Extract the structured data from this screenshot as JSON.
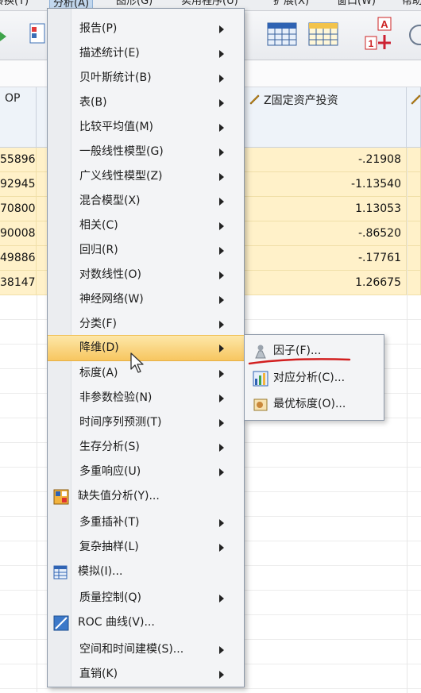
{
  "menubar": {
    "items": [
      "转换(T)",
      "分析(A)",
      "图形(G)",
      "实用程序(U)",
      "扩展(X)",
      "窗口(W)",
      "帮助"
    ]
  },
  "grid": {
    "headers": [
      "OP",
      "",
      "Z固定资产投资"
    ],
    "left_values": [
      "55896",
      "92945",
      "70800",
      "90008",
      "49886",
      "38147"
    ],
    "right_values": [
      "-.21908",
      "-1.13540",
      "1.13053",
      "-.86520",
      "-.17761",
      "1.26675"
    ]
  },
  "menu": {
    "items": [
      {
        "label": "报告(P)",
        "submenu": true
      },
      {
        "label": "描述统计(E)",
        "submenu": true
      },
      {
        "label": "贝叶斯统计(B)",
        "submenu": true
      },
      {
        "label": "表(B)",
        "submenu": true
      },
      {
        "label": "比较平均值(M)",
        "submenu": true
      },
      {
        "label": "一般线性模型(G)",
        "submenu": true
      },
      {
        "label": "广义线性模型(Z)",
        "submenu": true
      },
      {
        "label": "混合模型(X)",
        "submenu": true
      },
      {
        "label": "相关(C)",
        "submenu": true
      },
      {
        "label": "回归(R)",
        "submenu": true
      },
      {
        "label": "对数线性(O)",
        "submenu": true
      },
      {
        "label": "神经网络(W)",
        "submenu": true
      },
      {
        "label": "分类(F)",
        "submenu": true
      },
      {
        "label": "降维(D)",
        "submenu": true,
        "highlighted": true
      },
      {
        "label": "标度(A)",
        "submenu": true
      },
      {
        "label": "非参数检验(N)",
        "submenu": true
      },
      {
        "label": "时间序列预测(T)",
        "submenu": true
      },
      {
        "label": "生存分析(S)",
        "submenu": true
      },
      {
        "label": "多重响应(U)",
        "submenu": true
      },
      {
        "label": "缺失值分析(Y)...",
        "submenu": false,
        "icon": "missing-value-icon"
      },
      {
        "label": "多重插补(T)",
        "submenu": true
      },
      {
        "label": "复杂抽样(L)",
        "submenu": true
      },
      {
        "label": "模拟(I)...",
        "submenu": false,
        "icon": "simulation-icon"
      },
      {
        "label": "质量控制(Q)",
        "submenu": true
      },
      {
        "label": "ROC 曲线(V)...",
        "submenu": false,
        "icon": "roc-curve-icon"
      },
      {
        "label": "空间和时间建模(S)...",
        "submenu": true
      },
      {
        "label": "直销(K)",
        "submenu": true
      }
    ]
  },
  "submenu": {
    "items": [
      {
        "label": "因子(F)...",
        "icon": "factor-icon"
      },
      {
        "label": "对应分析(C)...",
        "icon": "correspondence-icon"
      },
      {
        "label": "最优标度(O)...",
        "icon": "optimal-scaling-icon"
      }
    ]
  },
  "colors": {
    "highlight": "#f7c660",
    "data_cell": "#fff1c9",
    "annotation_red": "#d21f1f"
  }
}
